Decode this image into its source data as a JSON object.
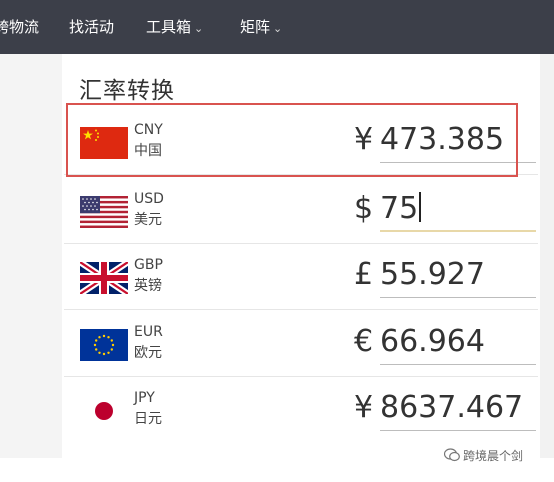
{
  "nav": {
    "items": [
      {
        "label": "跨物流"
      },
      {
        "label": "找活动"
      },
      {
        "label": "工具箱",
        "has_dropdown": true
      },
      {
        "label": "矩阵",
        "has_dropdown": true
      }
    ]
  },
  "converter": {
    "title": "汇率转换",
    "highlighted_currency": "CNY",
    "rows": [
      {
        "code": "CNY",
        "name": "中国",
        "symbol": "¥",
        "amount": "473.385",
        "flag_icon": "china-flag-icon"
      },
      {
        "code": "USD",
        "name": "美元",
        "symbol": "$",
        "amount": "75",
        "flag_icon": "usa-flag-icon",
        "active": true
      },
      {
        "code": "GBP",
        "name": "英镑",
        "symbol": "£",
        "amount": "55.927",
        "flag_icon": "uk-flag-icon"
      },
      {
        "code": "EUR",
        "name": "欧元",
        "symbol": "€",
        "amount": "66.964",
        "flag_icon": "eu-flag-icon"
      },
      {
        "code": "JPY",
        "name": "日元",
        "symbol": "¥",
        "amount": "8637.467",
        "flag_icon": "japan-flag-icon"
      }
    ]
  },
  "watermark": {
    "text": "跨境晨个剑",
    "icon": "wechat-icon"
  },
  "colors": {
    "nav_bg": "#3c3f49",
    "highlight": "#d9534f",
    "active_underline": "#e8d8a8"
  }
}
